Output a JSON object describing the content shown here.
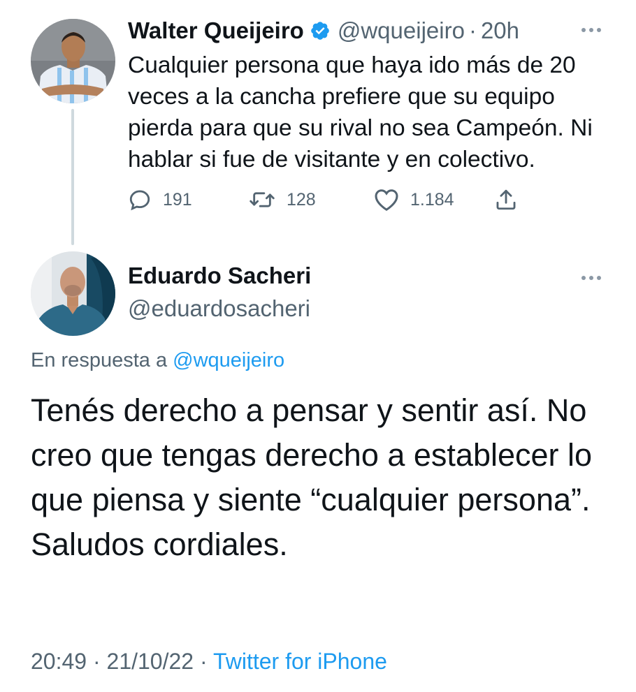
{
  "parent_tweet": {
    "name": "Walter Queijeiro",
    "handle": "@wqueijeiro",
    "separator": "·",
    "time": "20h",
    "text": "Cualquier persona que haya ido más de 20 veces a la cancha prefiere que su equipo pierda para que su rival no sea Campeón. Ni hablar si fue de visitante y en colectivo.",
    "replies": "191",
    "retweets": "128",
    "likes": "1.184",
    "verified": true
  },
  "reply_tweet": {
    "name": "Eduardo Sacheri",
    "handle": "@eduardosacheri",
    "reply_prefix": "En respuesta a",
    "reply_mention": "@wqueijeiro",
    "text": "Tenés derecho a pensar y sentir así. No creo que tengas derecho a establecer lo que piensa y siente “cualquier persona”. Saludos cordiales.",
    "time": "20:49",
    "separator1": "·",
    "date": "21/10/22",
    "separator2": "·",
    "source": "Twitter for iPhone"
  },
  "colors": {
    "accent": "#1d9bf0",
    "secondary_text": "#536471",
    "primary_text": "#0f1419",
    "thread_line": "#cfd9de"
  },
  "icons": {
    "reply": "reply-icon",
    "retweet": "retweet-icon",
    "like": "heart-icon",
    "share": "share-icon",
    "verified": "verified-badge-icon",
    "more": "more-options-icon"
  }
}
